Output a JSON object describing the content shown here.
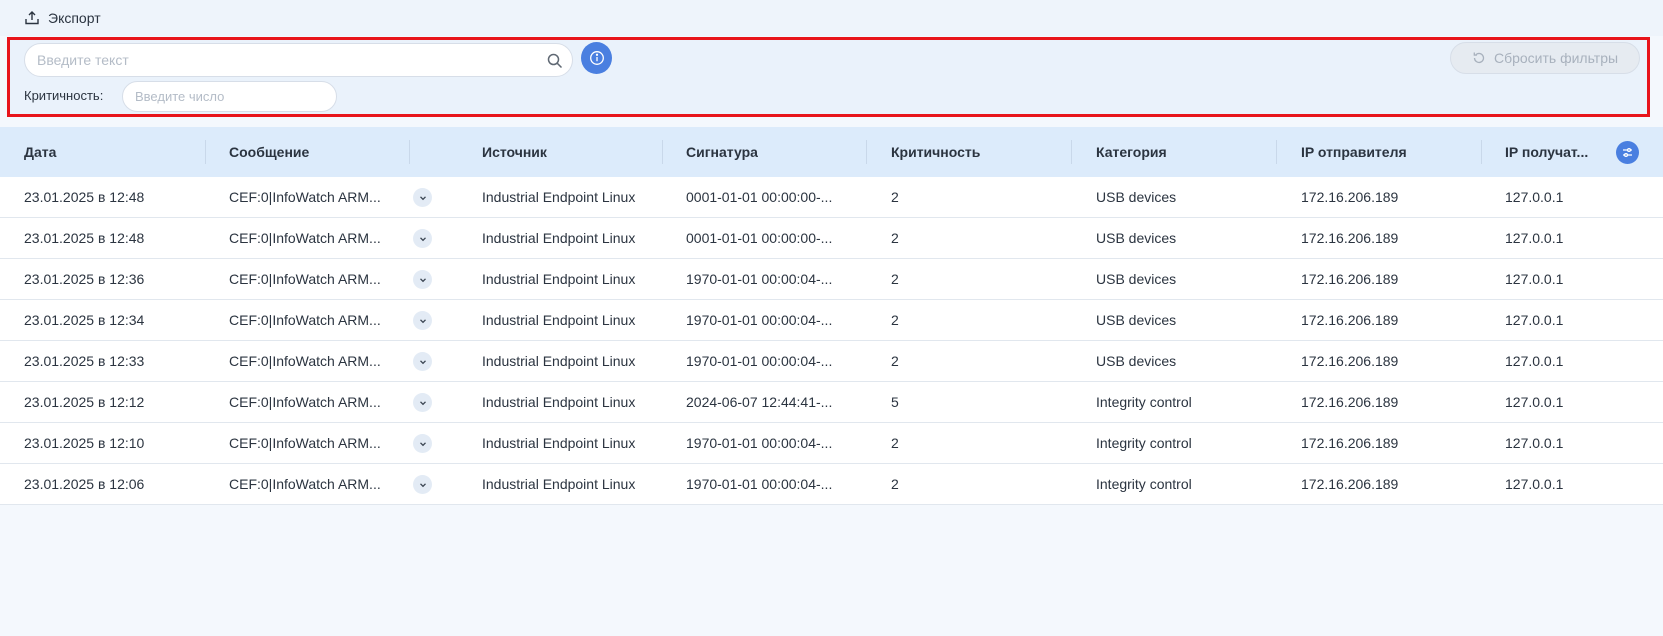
{
  "toolbar": {
    "export_label": "Экспорт",
    "export_icon": "upload-icon"
  },
  "filters": {
    "search_placeholder": "Введите текст",
    "search_value": "",
    "search_icon": "search-icon",
    "info_icon": "info-icon",
    "reset_label": "Сбросить фильтры",
    "reset_icon": "refresh-icon",
    "criticality_label": "Критичность:",
    "criticality_placeholder": "Введите число",
    "criticality_value": ""
  },
  "table": {
    "columns": [
      {
        "key": "date",
        "label": "Дата"
      },
      {
        "key": "message",
        "label": "Сообщение"
      },
      {
        "key": "source",
        "label": "Источник"
      },
      {
        "key": "signature",
        "label": "Сигнатура"
      },
      {
        "key": "criticality",
        "label": "Критичность"
      },
      {
        "key": "category",
        "label": "Категория"
      },
      {
        "key": "ip_sender",
        "label": "IP отправителя"
      },
      {
        "key": "ip_receiver",
        "label": "IP получат..."
      }
    ],
    "settings_icon": "sliders-icon",
    "rows": [
      {
        "date": "23.01.2025 в 12:48",
        "message": "CEF:0|InfoWatch ARM...",
        "source": "Industrial Endpoint Linux",
        "signature": "0001-01-01 00:00:00-...",
        "criticality": "2",
        "category": "USB devices",
        "ip_sender": "172.16.206.189",
        "ip_receiver": "127.0.0.1"
      },
      {
        "date": "23.01.2025 в 12:48",
        "message": "CEF:0|InfoWatch ARM...",
        "source": "Industrial Endpoint Linux",
        "signature": "0001-01-01 00:00:00-...",
        "criticality": "2",
        "category": "USB devices",
        "ip_sender": "172.16.206.189",
        "ip_receiver": "127.0.0.1"
      },
      {
        "date": "23.01.2025 в 12:36",
        "message": "CEF:0|InfoWatch ARM...",
        "source": "Industrial Endpoint Linux",
        "signature": "1970-01-01 00:00:04-...",
        "criticality": "2",
        "category": "USB devices",
        "ip_sender": "172.16.206.189",
        "ip_receiver": "127.0.0.1"
      },
      {
        "date": "23.01.2025 в 12:34",
        "message": "CEF:0|InfoWatch ARM...",
        "source": "Industrial Endpoint Linux",
        "signature": "1970-01-01 00:00:04-...",
        "criticality": "2",
        "category": "USB devices",
        "ip_sender": "172.16.206.189",
        "ip_receiver": "127.0.0.1"
      },
      {
        "date": "23.01.2025 в 12:33",
        "message": "CEF:0|InfoWatch ARM...",
        "source": "Industrial Endpoint Linux",
        "signature": "1970-01-01 00:00:04-...",
        "criticality": "2",
        "category": "USB devices",
        "ip_sender": "172.16.206.189",
        "ip_receiver": "127.0.0.1"
      },
      {
        "date": "23.01.2025 в 12:12",
        "message": "CEF:0|InfoWatch ARM...",
        "source": "Industrial Endpoint Linux",
        "signature": "2024-06-07 12:44:41-...",
        "criticality": "5",
        "category": "Integrity control",
        "ip_sender": "172.16.206.189",
        "ip_receiver": "127.0.0.1"
      },
      {
        "date": "23.01.2025 в 12:10",
        "message": "CEF:0|InfoWatch ARM...",
        "source": "Industrial Endpoint Linux",
        "signature": "1970-01-01 00:00:04-...",
        "criticality": "2",
        "category": "Integrity control",
        "ip_sender": "172.16.206.189",
        "ip_receiver": "127.0.0.1"
      },
      {
        "date": "23.01.2025 в 12:06",
        "message": "CEF:0|InfoWatch ARM...",
        "source": "Industrial Endpoint Linux",
        "signature": "1970-01-01 00:00:04-...",
        "criticality": "2",
        "category": "Integrity control",
        "ip_sender": "172.16.206.189",
        "ip_receiver": "127.0.0.1"
      }
    ]
  },
  "colors": {
    "accent": "#4a7fe0",
    "highlight_border": "#e8141b",
    "header_bg": "#dcebfb"
  }
}
